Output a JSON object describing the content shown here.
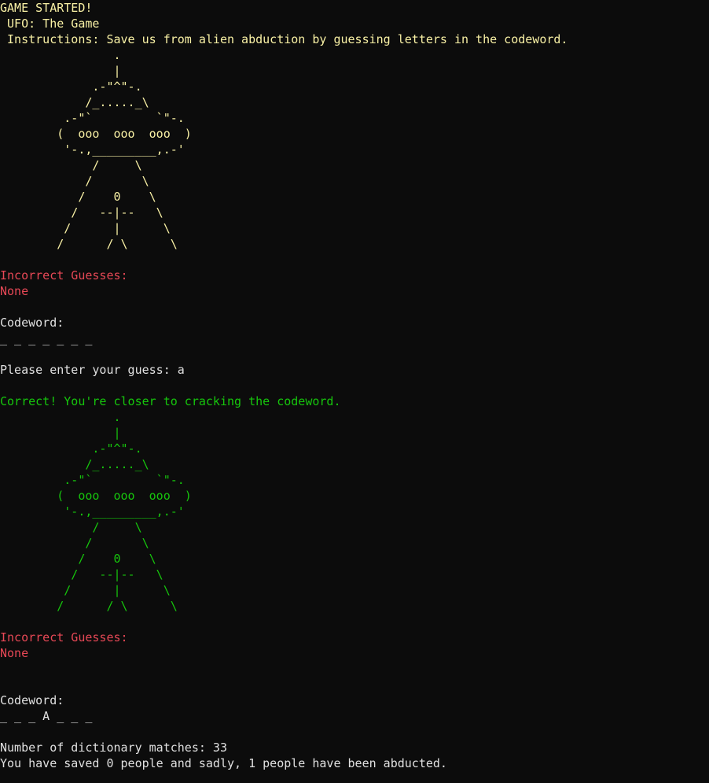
{
  "header": {
    "game_started": "GAME STARTED!",
    "title_line": " UFO: The Game",
    "instructions_line": " Instructions: Save us from alien abduction by guessing letters in the codeword."
  },
  "round1": {
    "ufo_art": "                .\n                |\n             .-\"^\"-.\n            /_....._\\\n         .-\"`         `\"-.\n        (  ooo  ooo  ooo  )\n         '-.,_________,.-'\n             /     \\\n            /       \\\n           /    0    \\\n          /   --|--   \\\n         /      |      \\\n        /      / \\      \\",
    "incorrect_label": "Incorrect Guesses:",
    "incorrect_value": "None",
    "codeword_label": "Codeword:",
    "codeword_value": "_ _ _ _ _ _ _",
    "prompt": "Please enter your guess: a"
  },
  "feedback": "Correct! You're closer to cracking the codeword.",
  "round2": {
    "ufo_art": "                .\n                |\n             .-\"^\"-.\n            /_....._\\\n         .-\"`         `\"-.\n        (  ooo  ooo  ooo  )\n         '-.,_________,.-'\n             /     \\\n            /       \\\n           /    0    \\\n          /   --|--   \\\n         /      |      \\\n        /      / \\      \\",
    "incorrect_label": "Incorrect Guesses:",
    "incorrect_value": "None",
    "codeword_label": "Codeword:",
    "codeword_value": "_ _ _ A _ _ _"
  },
  "footer": {
    "matches_line": "Number of dictionary matches: 33",
    "status_line": "You have saved 0 people and sadly, 1 people have been abducted."
  },
  "colors": {
    "background": "#0c0c0c",
    "yellow": "#f9f1a5",
    "red": "#e74856",
    "green": "#16c60c",
    "white": "#e0e0e0"
  }
}
